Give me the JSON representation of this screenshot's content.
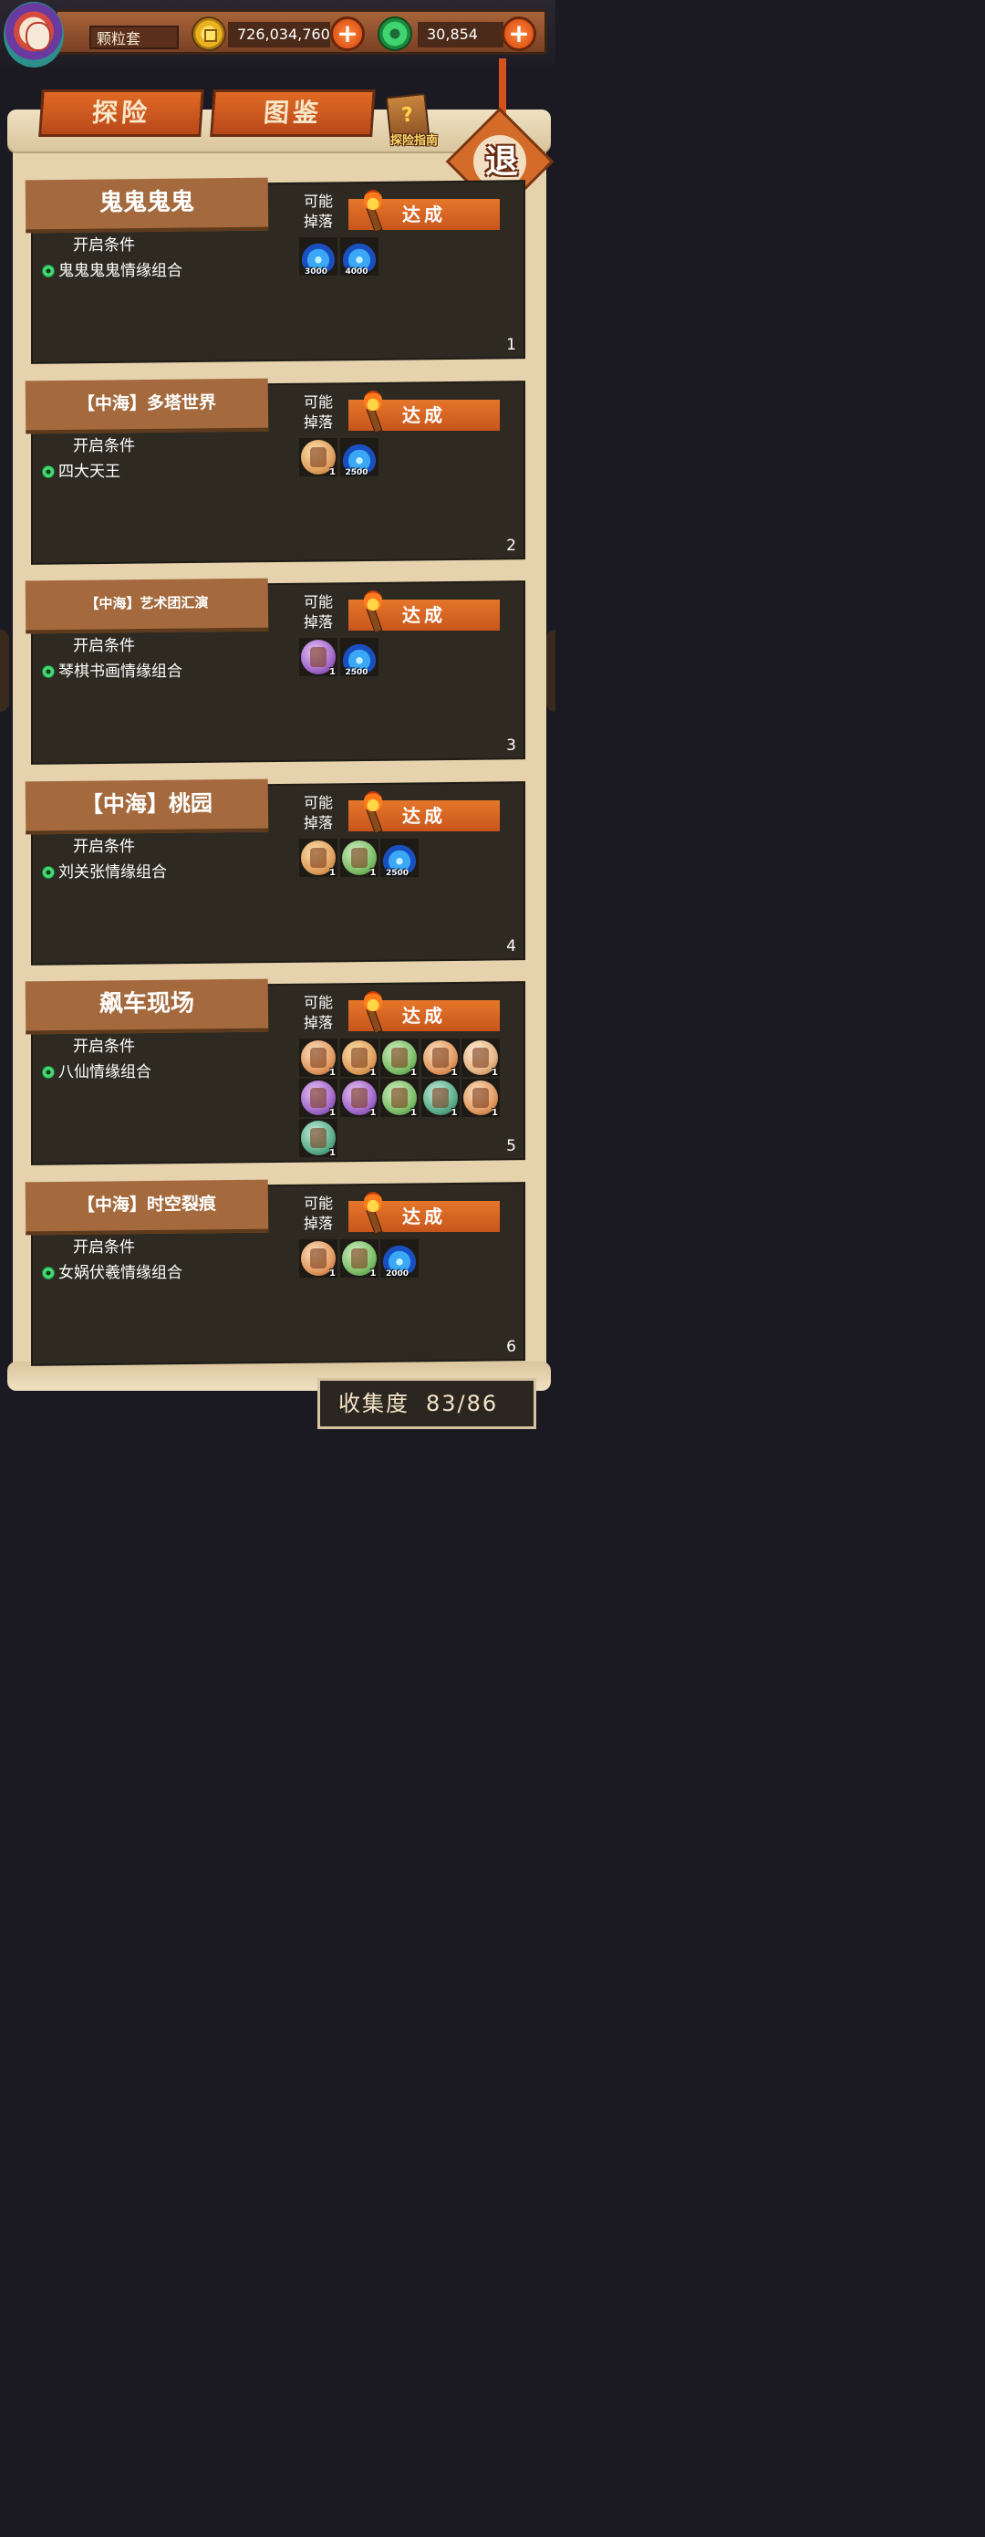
{
  "player": {
    "name": "颗粒套"
  },
  "currency": {
    "gold": "726,034,760",
    "jade": "30,854",
    "plus_symbol": "+"
  },
  "tabs": {
    "explore": "探险",
    "atlas": "图鉴"
  },
  "guide": {
    "icon_symbol": "?",
    "label": "探险指南"
  },
  "exit": {
    "label": "退"
  },
  "common": {
    "drop_label": "可能 掉落",
    "achieve": "达成",
    "condition_label": "开启条件"
  },
  "cards": [
    {
      "title": "鬼鬼鬼鬼",
      "condition": "鬼鬼鬼鬼情缘组合",
      "index": "1",
      "items": [
        {
          "type": "flame",
          "qty": "3000"
        },
        {
          "type": "flame",
          "qty": "4000"
        }
      ]
    },
    {
      "title": "【中海】多塔世界",
      "condition": "四大天王",
      "index": "2",
      "items": [
        {
          "type": "orb",
          "color": "sand",
          "qty": "1"
        },
        {
          "type": "flame",
          "qty": "2500"
        }
      ]
    },
    {
      "title": "【中海】艺术团汇演",
      "condition": "琴棋书画情缘组合",
      "index": "3",
      "items": [
        {
          "type": "orb",
          "color": "purple",
          "qty": "1"
        },
        {
          "type": "flame",
          "qty": "2500"
        }
      ]
    },
    {
      "title": "【中海】桃园",
      "condition": "刘关张情缘组合",
      "index": "4",
      "items": [
        {
          "type": "orb",
          "color": "sand",
          "qty": "1"
        },
        {
          "type": "orb",
          "color": "green",
          "qty": "1"
        },
        {
          "type": "flame",
          "qty": "2500"
        }
      ]
    },
    {
      "title": "飙车现场",
      "condition": "八仙情缘组合",
      "index": "5",
      "items": [
        {
          "type": "orb",
          "color": "peach",
          "qty": "1"
        },
        {
          "type": "orb",
          "color": "sand",
          "qty": "1"
        },
        {
          "type": "orb",
          "color": "green",
          "qty": "1"
        },
        {
          "type": "orb",
          "color": "peach",
          "qty": "1"
        },
        {
          "type": "orb",
          "color": "cream",
          "qty": "1"
        },
        {
          "type": "orb",
          "color": "purple",
          "qty": "1"
        },
        {
          "type": "orb",
          "color": "purple",
          "qty": "1"
        },
        {
          "type": "orb",
          "color": "green",
          "qty": "1"
        },
        {
          "type": "orb",
          "color": "teal",
          "qty": "1"
        },
        {
          "type": "orb",
          "color": "peach",
          "qty": "1"
        },
        {
          "type": "orb",
          "color": "teal",
          "qty": "1"
        }
      ]
    },
    {
      "title": "【中海】时空裂痕",
      "condition": "女娲伏羲情缘组合",
      "index": "6",
      "items": [
        {
          "type": "orb",
          "color": "peach",
          "qty": "1"
        },
        {
          "type": "orb",
          "color": "green",
          "qty": "1"
        },
        {
          "type": "flame",
          "qty": "2000"
        }
      ]
    }
  ],
  "collection": {
    "label": "收集度",
    "value": "83/86"
  }
}
